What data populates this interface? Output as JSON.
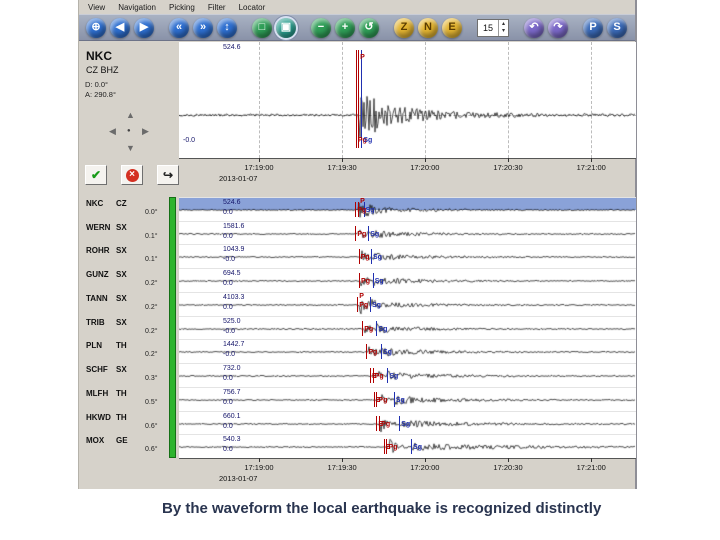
{
  "caption": "By the waveform the local earthquake is recognized distinctly",
  "menu": {
    "items": [
      "View",
      "Navigation",
      "Picking",
      "Filter",
      "Locator"
    ]
  },
  "icons": {
    "spin_up": "▴",
    "spin_down": "▾"
  },
  "toolbar": {
    "items": [
      {
        "type": "button",
        "name": "overview-button",
        "glyph": "⊕",
        "bg": "#2e6fd0"
      },
      {
        "type": "button",
        "name": "step-back-button",
        "glyph": "◀",
        "bg": "#2e6fd0"
      },
      {
        "type": "button",
        "name": "step-forward-button",
        "glyph": "▶",
        "bg": "#2e6fd0"
      },
      {
        "type": "spacer"
      },
      {
        "type": "button",
        "name": "shift-left-button",
        "glyph": "«",
        "bg": "#2e6fd0"
      },
      {
        "type": "button",
        "name": "shift-right-button",
        "glyph": "»",
        "bg": "#2e6fd0"
      },
      {
        "type": "button",
        "name": "pan-button",
        "glyph": "↕",
        "bg": "#2e6fd0"
      },
      {
        "type": "spacer"
      },
      {
        "type": "button",
        "name": "zoom-window-button",
        "glyph": "□",
        "bg": "#2f9e57"
      },
      {
        "type": "button",
        "name": "zoom-selected-button",
        "glyph": "▣",
        "bg": "#2a9e8f",
        "pressed": true
      },
      {
        "type": "spacer"
      },
      {
        "type": "button",
        "name": "zoom-out-button",
        "glyph": "−",
        "bg": "#2f9e57"
      },
      {
        "type": "button",
        "name": "zoom-in-button",
        "glyph": "+",
        "bg": "#2f9e57"
      },
      {
        "type": "button",
        "name": "zoom-reset-button",
        "glyph": "↺",
        "bg": "#2f9e57"
      },
      {
        "type": "spacer"
      },
      {
        "type": "button",
        "name": "component-z-button",
        "glyph": "Z",
        "bg": "#e3b431",
        "fg": "#5a3c00"
      },
      {
        "type": "button",
        "name": "component-n-button",
        "glyph": "N",
        "bg": "#e3b431",
        "fg": "#5a3c00"
      },
      {
        "type": "button",
        "name": "component-e-button",
        "glyph": "E",
        "bg": "#e3b431",
        "fg": "#5a3c00"
      },
      {
        "type": "spacer"
      },
      {
        "type": "spinner",
        "value": "15"
      },
      {
        "type": "spacer"
      },
      {
        "type": "button",
        "name": "undo-button",
        "glyph": "↶",
        "bg": "#7b68c8"
      },
      {
        "type": "button",
        "name": "redo-button",
        "glyph": "↷",
        "bg": "#7b68c8"
      },
      {
        "type": "spacer"
      },
      {
        "type": "button",
        "name": "phase-p-button",
        "glyph": "P",
        "bg": "#3a6ab8"
      },
      {
        "type": "button",
        "name": "phase-s-button",
        "glyph": "S",
        "bg": "#3a6ab8"
      }
    ]
  },
  "station_info": {
    "code": "NKC",
    "channel": "CZ BHZ",
    "delta": "D: 0.0°",
    "azimuth": "A: 290.8°"
  },
  "nav_pad": {
    "up": "▲",
    "left": "◀",
    "center": "●",
    "right": "▶",
    "down": "▼"
  },
  "actions": [
    {
      "name": "confirm-button",
      "glyph": "✔",
      "color": "#189b18"
    },
    {
      "name": "cancel-button",
      "glyph": "×",
      "circle": true
    },
    {
      "name": "export-button",
      "glyph": "↪",
      "color": "#222222"
    }
  ],
  "stations": [
    {
      "code": "NKC",
      "net": "CZ",
      "dist": "0.0°"
    },
    {
      "code": "WERN",
      "net": "SX",
      "dist": "0.1°"
    },
    {
      "code": "ROHR",
      "net": "SX",
      "dist": "0.1°"
    },
    {
      "code": "GUNZ",
      "net": "SX",
      "dist": "0.2°"
    },
    {
      "code": "TANN",
      "net": "SX",
      "dist": "0.2°"
    },
    {
      "code": "TRIB",
      "net": "SX",
      "dist": "0.2°"
    },
    {
      "code": "PLN",
      "net": "TH",
      "dist": "0.2°"
    },
    {
      "code": "SCHF",
      "net": "SX",
      "dist": "0.3°"
    },
    {
      "code": "MLFH",
      "net": "TH",
      "dist": "0.5°"
    },
    {
      "code": "HKWD",
      "net": "TH",
      "dist": "0.6°"
    },
    {
      "code": "MOX",
      "net": "GE",
      "dist": "0.6°"
    }
  ],
  "time_axis": {
    "ticks": [
      "17:19:00",
      "17:19:30",
      "17:20:00",
      "17:20:30",
      "17:21:00"
    ],
    "fracs": [
      0.175,
      0.357,
      0.538,
      0.72,
      0.902
    ],
    "date": "2013-01-07"
  },
  "top_plot": {
    "max": "524.6",
    "min": "-0.0",
    "wave": {
      "seed": 42,
      "onset": 0.392,
      "sg": 0.404,
      "amp": 40,
      "decay": 9,
      "samp": 13,
      "sdecay": 60,
      "noise": 1.1,
      "base": 0.63
    },
    "picks": [
      {
        "label": "P",
        "color": "#b00000",
        "frac": 0.392,
        "at": "top"
      },
      {
        "label": "Pg",
        "color": "#b00000",
        "frac": 0.387,
        "at": "bottom"
      },
      {
        "label": "Sg",
        "color": "#2030b0",
        "frac": 0.399,
        "at": "bottom"
      }
    ]
  },
  "panel_traces": [
    {
      "station": "NKC",
      "selected": true,
      "max": "524.6",
      "min": "0.0",
      "wave": {
        "seed": 11,
        "onset": 0.392,
        "sg": 0.404,
        "amp": 9,
        "decay": 8,
        "samp": 3.5,
        "sdecay": 45,
        "noise": 0.6
      },
      "picks": [
        {
          "label": "P",
          "color": "#b00000",
          "frac": 0.392,
          "at": "top"
        },
        {
          "label": "Pg",
          "color": "#b00000",
          "frac": 0.386
        },
        {
          "label": "Sg",
          "color": "#2030b0",
          "frac": 0.404
        }
      ]
    },
    {
      "station": "WERN",
      "max": "1581.6",
      "min": "0.0",
      "wave": {
        "seed": 22,
        "onset": 0.39,
        "sg": 0.414,
        "amp": 8,
        "decay": 8,
        "samp": 3.5,
        "sdecay": 45,
        "noise": 0.6
      },
      "picks": [
        {
          "label": "Pg",
          "color": "#b00000",
          "frac": 0.386
        },
        {
          "label": "Sg",
          "color": "#2030b0",
          "frac": 0.414
        }
      ]
    },
    {
      "station": "ROHR",
      "max": "1043.9",
      "min": "-0.0",
      "wave": {
        "seed": 33,
        "onset": 0.397,
        "sg": 0.42,
        "amp": 7,
        "decay": 8,
        "samp": 3.5,
        "sdecay": 45,
        "noise": 0.6
      },
      "picks": [
        {
          "label": "Pg",
          "color": "#b00000",
          "frac": 0.393
        },
        {
          "label": "Sg",
          "color": "#2030b0",
          "frac": 0.42
        }
      ]
    },
    {
      "station": "GUNZ",
      "max": "694.5",
      "min": "0.0",
      "wave": {
        "seed": 44,
        "onset": 0.398,
        "sg": 0.424,
        "amp": 8,
        "decay": 8,
        "samp": 3.5,
        "sdecay": 45,
        "noise": 0.6
      },
      "picks": [
        {
          "label": "Pg",
          "color": "#b00000",
          "frac": 0.394
        },
        {
          "label": "Sg",
          "color": "#2030b0",
          "frac": 0.424
        }
      ]
    },
    {
      "station": "TANN",
      "max": "4103.3",
      "min": "0.0",
      "wave": {
        "seed": 55,
        "onset": 0.394,
        "sg": 0.418,
        "amp": 11,
        "decay": 8,
        "samp": 3.5,
        "sdecay": 45,
        "noise": 0.6
      },
      "picks": [
        {
          "label": "P",
          "color": "#b00000",
          "frac": 0.39,
          "at": "top"
        },
        {
          "label": "Pg",
          "color": "#b00000",
          "frac": 0.39
        },
        {
          "label": "Sg",
          "color": "#2030b0",
          "frac": 0.418
        }
      ]
    },
    {
      "station": "TRIB",
      "max": "525.0",
      "min": "-0.0",
      "wave": {
        "seed": 66,
        "onset": 0.405,
        "sg": 0.432,
        "amp": 7,
        "decay": 8,
        "samp": 3.5,
        "sdecay": 45,
        "noise": 0.6
      },
      "picks": [
        {
          "label": "Pg",
          "color": "#b00000",
          "frac": 0.401
        },
        {
          "label": "Sg",
          "color": "#2030b0",
          "frac": 0.432
        }
      ]
    },
    {
      "station": "PLN",
      "max": "1442.7",
      "min": "-0.0",
      "wave": {
        "seed": 77,
        "onset": 0.414,
        "sg": 0.442,
        "amp": 8,
        "decay": 8,
        "samp": 3.5,
        "sdecay": 45,
        "noise": 0.6
      },
      "picks": [
        {
          "label": "Pg",
          "color": "#b00000",
          "frac": 0.41
        },
        {
          "label": "Sg",
          "color": "#2030b0",
          "frac": 0.442
        }
      ]
    },
    {
      "station": "SCHF",
      "max": "732.0",
      "min": "0.0",
      "wave": {
        "seed": 88,
        "onset": 0.428,
        "sg": 0.456,
        "amp": 7,
        "decay": 8,
        "samp": 3.5,
        "sdecay": 50,
        "noise": 0.6
      },
      "picks": [
        {
          "label": "E",
          "color": "#b00000",
          "frac": 0.418
        },
        {
          "label": "Pg",
          "color": "#b00000",
          "frac": 0.424
        },
        {
          "label": "Sg",
          "color": "#2030b0",
          "frac": 0.456
        }
      ]
    },
    {
      "station": "MLFH",
      "max": "756.7",
      "min": "0.0",
      "wave": {
        "seed": 99,
        "onset": 0.436,
        "sg": 0.47,
        "amp": 8,
        "decay": 8,
        "samp": 3.5,
        "sdecay": 55,
        "noise": 0.6
      },
      "picks": [
        {
          "label": "E",
          "color": "#b00000",
          "frac": 0.426
        },
        {
          "label": "Pg",
          "color": "#b00000",
          "frac": 0.432
        },
        {
          "label": "Sg",
          "color": "#2030b0",
          "frac": 0.47
        }
      ]
    },
    {
      "station": "HKWD",
      "max": "660.1",
      "min": "0.0",
      "wave": {
        "seed": 110,
        "onset": 0.442,
        "sg": 0.482,
        "amp": 8,
        "decay": 8,
        "samp": 3.5,
        "sdecay": 60,
        "noise": 0.6
      },
      "picks": [
        {
          "label": "E",
          "color": "#b00000",
          "frac": 0.432
        },
        {
          "label": "Pg",
          "color": "#b00000",
          "frac": 0.438
        },
        {
          "label": "Sg",
          "color": "#2030b0",
          "frac": 0.482
        }
      ]
    },
    {
      "station": "MOX",
      "max": "540.3",
      "min": "0.0",
      "wave": {
        "seed": 121,
        "onset": 0.458,
        "sg": 0.508,
        "amp": 9,
        "decay": 8,
        "samp": 3.5,
        "sdecay": 85,
        "noise": 0.6
      },
      "picks": [
        {
          "label": "E",
          "color": "#b00000",
          "frac": 0.448
        },
        {
          "label": "Pg",
          "color": "#b00000",
          "frac": 0.454
        },
        {
          "label": "Sg",
          "color": "#2030b0",
          "frac": 0.508
        }
      ]
    }
  ]
}
